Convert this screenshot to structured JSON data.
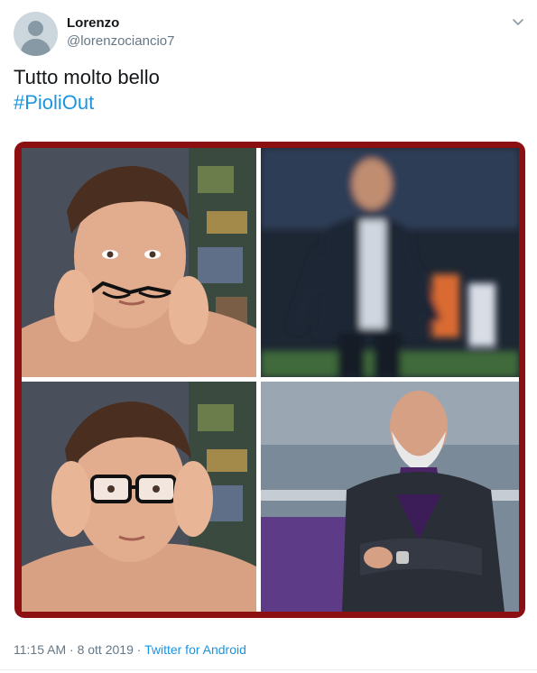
{
  "user": {
    "name": "Lorenzo",
    "handle": "@lorenzociancio7"
  },
  "tweet": {
    "text": "Tutto molto bello",
    "hashtag": "#PioliOut"
  },
  "footer": {
    "time": "11:15 AM",
    "separator": "·",
    "date": "8 ott 2019",
    "source": "Twitter for Android"
  },
  "icons": {
    "menu": "chevron-down-icon",
    "avatar": "default-avatar"
  },
  "colors": {
    "hashtag": "#1b95e0",
    "frame": "#8c0f12",
    "secondary_text": "#657786"
  }
}
